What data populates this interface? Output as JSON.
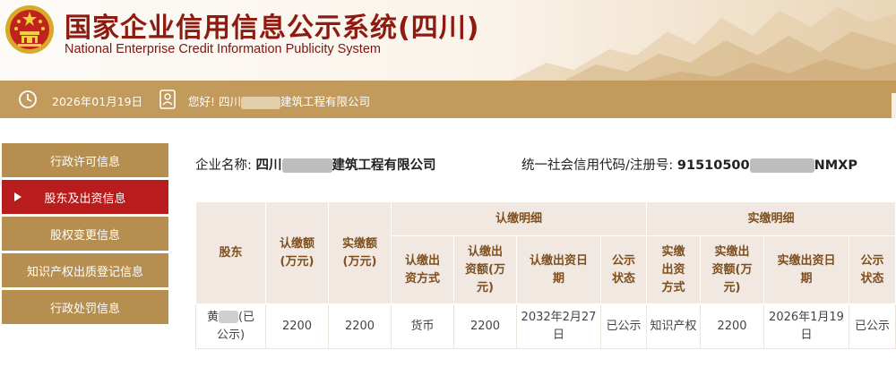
{
  "header": {
    "title_cn": "国家企业信用信息公示系统(四川)",
    "title_en": "National Enterprise Credit Information Publicity System"
  },
  "infobar": {
    "date": "2026年01月19日",
    "greeting_prefix": "您好! 四川",
    "greeting_suffix": "建筑工程有限公司"
  },
  "sidebar": {
    "items": [
      {
        "label": "行政许可信息"
      },
      {
        "label": "股东及出资信息"
      },
      {
        "label": "股权变更信息"
      },
      {
        "label": "知识产权出质登记信息"
      },
      {
        "label": "行政处罚信息"
      }
    ],
    "active_index": 1
  },
  "company": {
    "name_label": "企业名称:",
    "name_prefix": "四川",
    "name_suffix": "建筑工程有限公司",
    "code_label": "统一社会信用代码/注册号:",
    "code_prefix": "91510500",
    "code_suffix": "NMXP"
  },
  "table": {
    "h_shareholder": "股东",
    "h_subscribed_amount": "认缴额\n(万元)",
    "h_paid_amount": "实缴额\n(万元)",
    "h_subscribed_detail": "认缴明细",
    "h_paid_detail": "实缴明细",
    "h_sub_method": "认缴出\n资方式",
    "h_sub_amount": "认缴出\n资额(万\n元)",
    "h_sub_date": "认缴出资日\n期",
    "h_sub_status": "公示\n状态",
    "h_paid_method": "实缴\n出资\n方式",
    "h_paid_amount2": "实缴出\n资额(万\n元)",
    "h_paid_date": "实缴出资日\n期",
    "h_paid_status": "公示\n状态",
    "rows": [
      {
        "shareholder_prefix": "黄",
        "shareholder_suffix": "(已\n公示)",
        "subscribed": "2200",
        "paid": "2200",
        "sub_method": "货币",
        "sub_amount": "2200",
        "sub_date": "2032年2月27\n日",
        "sub_status": "已公示",
        "paid_method": "知识产权",
        "paid_amount": "2200",
        "paid_date": "2026年1月19\n日",
        "paid_status": "已公示"
      }
    ]
  },
  "colors": {
    "brand_red": "#8f1a10",
    "gold": "#c29a5b",
    "sidebar_gold": "#b68e4f",
    "active_red": "#b81c1c",
    "table_header_bg": "#f1e9e1"
  },
  "icons": {
    "emblem": "national-emblem-icon",
    "date": "clock-icon",
    "user": "user-badge-icon"
  }
}
